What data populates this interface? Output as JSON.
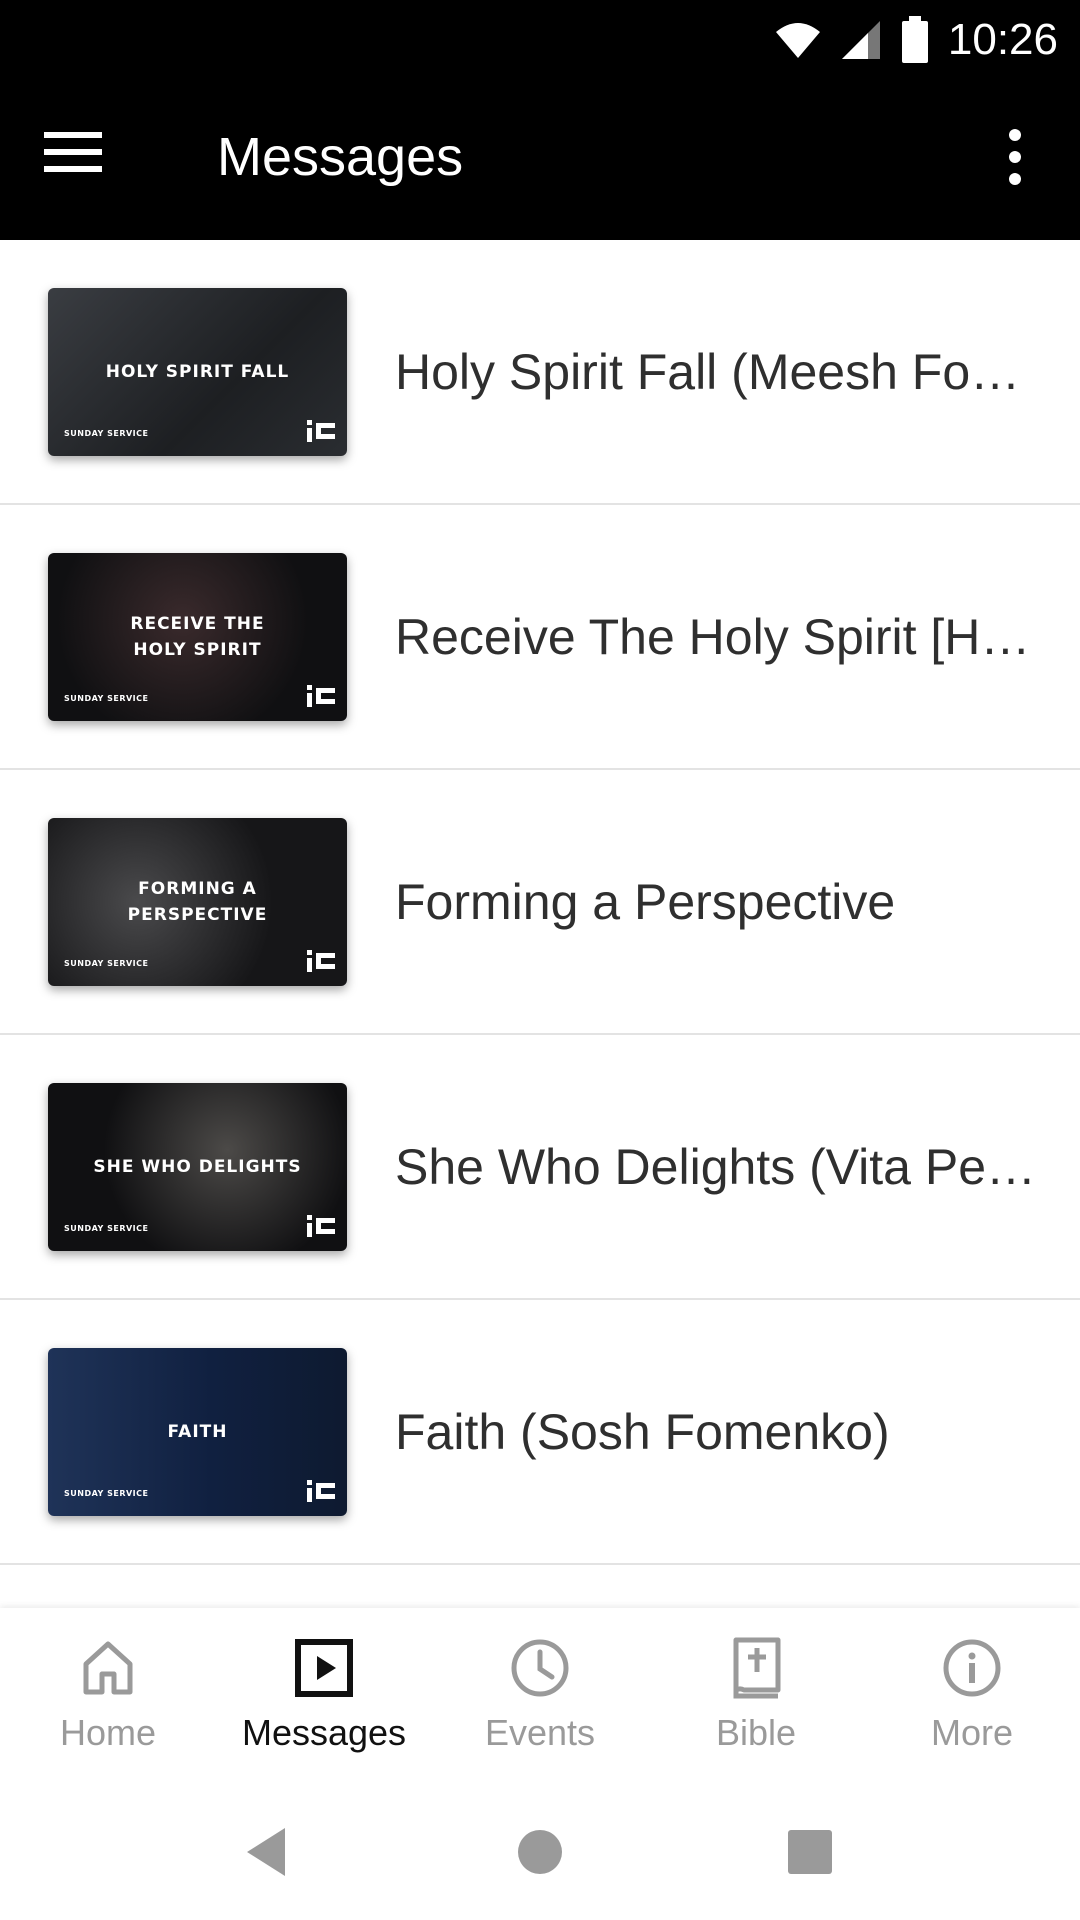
{
  "status_bar": {
    "time": "10:26"
  },
  "app_bar": {
    "title": "Messages"
  },
  "messages": [
    {
      "title": "Holy Spirit Fall (Meesh Fo…",
      "thumb_title": "HOLY SPIRIT FALL",
      "thumb_sub": "SUNDAY SERVICE",
      "thumb_bg": "#2a2c30"
    },
    {
      "title": "Receive The Holy Spirit [H…",
      "thumb_title": "RECEIVE THE HOLY SPIRIT",
      "thumb_sub": "SUNDAY SERVICE",
      "thumb_bg": "#141416"
    },
    {
      "title": "Forming a Perspective",
      "thumb_title": "FORMING A PERSPECTIVE",
      "thumb_sub": "SUNDAY SERVICE",
      "thumb_bg": "#1b1b1d"
    },
    {
      "title": "She Who Delights (Vita Pe…",
      "thumb_title": "SHE WHO DELIGHTS",
      "thumb_sub": "SUNDAY SERVICE",
      "thumb_bg": "#131315"
    },
    {
      "title": "Faith (Sosh Fomenko)",
      "thumb_title": "FAITH",
      "thumb_sub": "SUNDAY SERVICE",
      "thumb_bg": "#16243e"
    }
  ],
  "bottom_nav": {
    "items": [
      {
        "label": "Home",
        "icon": "home-icon"
      },
      {
        "label": "Messages",
        "icon": "play-square-icon",
        "active": true
      },
      {
        "label": "Events",
        "icon": "clock-icon"
      },
      {
        "label": "Bible",
        "icon": "bible-icon"
      },
      {
        "label": "More",
        "icon": "info-icon"
      }
    ]
  },
  "colors": {
    "bar_bg": "#000000",
    "title_text": "#2f2f2f",
    "nav_inactive": "#9a9a9a",
    "nav_active": "#111111"
  }
}
